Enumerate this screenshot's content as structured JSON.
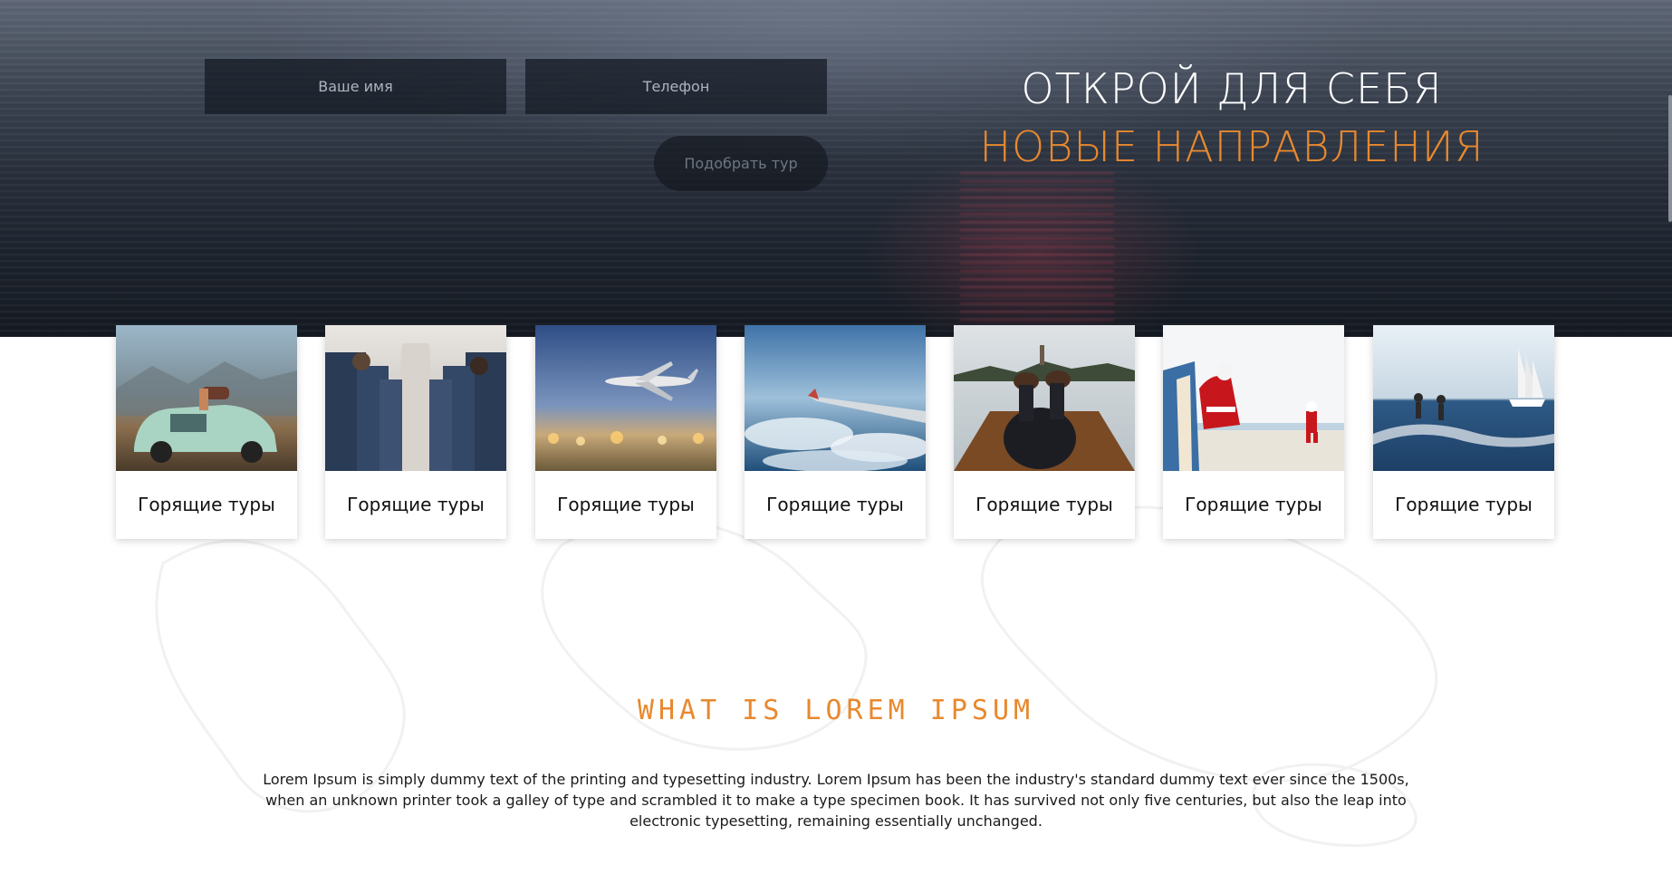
{
  "hero": {
    "name_placeholder": "Ваше имя",
    "phone_placeholder": "Телефон",
    "submit_label": "Подобрать тур",
    "headline_line1": "ОТКРОЙ ДЛЯ СЕБЯ",
    "headline_line2": "НОВЫЕ НАПРАВЛЕНИЯ",
    "accent_color": "#e8892e"
  },
  "cards": [
    {
      "title": "Горящие туры",
      "image": "vintage-car-mountains"
    },
    {
      "title": "Горящие туры",
      "image": "airplane-cabin"
    },
    {
      "title": "Горящие туры",
      "image": "airplane-landing-city"
    },
    {
      "title": "Горящие туры",
      "image": "airplane-wing-clouds"
    },
    {
      "title": "Горящие туры",
      "image": "feet-on-boat-lake"
    },
    {
      "title": "Горящие туры",
      "image": "santa-on-beach"
    },
    {
      "title": "Горящие туры",
      "image": "water-ski-sailboat"
    }
  ],
  "about": {
    "title": "WHAT IS LOREM IPSUM",
    "text": "Lorem Ipsum is simply dummy text of the printing and typesetting industry. Lorem Ipsum has been the industry's standard dummy text ever since the 1500s, when an unknown printer took a galley of type and scrambled it to make a type specimen book. It has survived not only five centuries, but also the leap into electronic typesetting, remaining essentially unchanged."
  }
}
